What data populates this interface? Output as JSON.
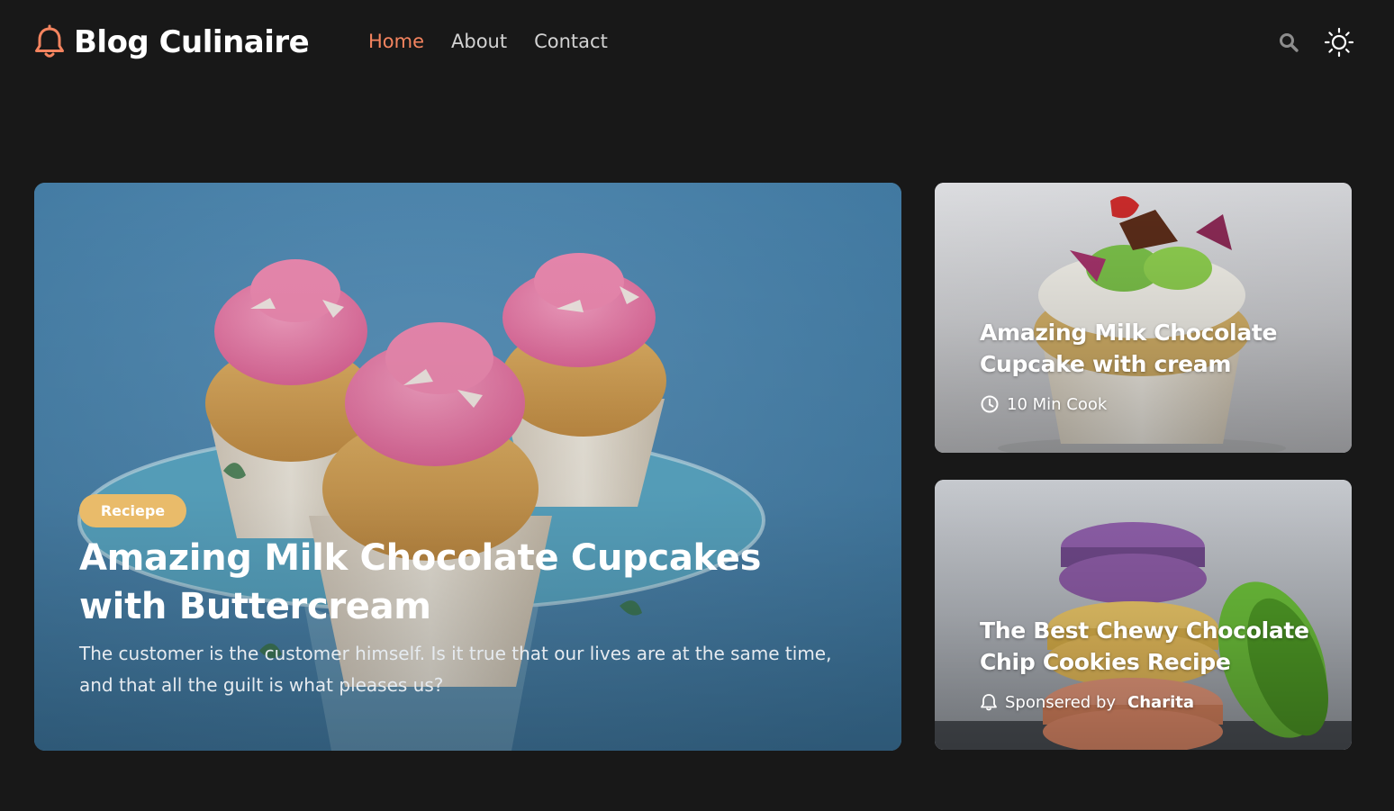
{
  "brand": {
    "name": "Blog Culinaire",
    "accent": "#f4845f"
  },
  "nav": {
    "items": [
      {
        "label": "Home",
        "active": true
      },
      {
        "label": "About",
        "active": false
      },
      {
        "label": "Contact",
        "active": false
      }
    ]
  },
  "header_actions": {
    "search_icon": "search-icon",
    "theme_icon": "sun-icon"
  },
  "featured": {
    "badge": "Reciepe",
    "badge_color": "#e9bb6a",
    "title": "Amazing Milk Chocolate Cupcakes with Buttercream",
    "excerpt": "The customer is the customer himself. Is it true that our lives are at the same time, and that all the guilt is what pleases us?",
    "image": "three-pink-frosted-cupcakes-on-glass-stand"
  },
  "side_cards": [
    {
      "title": "Amazing Milk Chocolate Cupcake with cream",
      "meta_icon": "clock-icon",
      "meta_text": "10 Min Cook",
      "image": "cupcake-with-strawberry-and-chocolate-topping"
    },
    {
      "title": "The Best Chewy Chocolate Chip Cookies Recipe",
      "meta_icon": "bell-icon",
      "meta_prefix": "Sponsered by",
      "meta_author": "Charita",
      "image": "stacked-colorful-macarons"
    }
  ],
  "colors": {
    "background": "#181818",
    "nav_text": "#d2d2d2"
  }
}
